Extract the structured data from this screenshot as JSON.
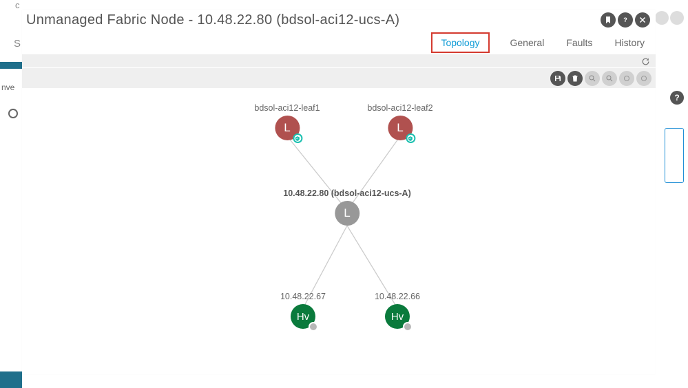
{
  "header": {
    "title": "Unmanaged Fabric Node - 10.48.22.80 (bdsol-aci12-ucs-A)"
  },
  "tabs": {
    "items": [
      "Topology",
      "General",
      "Faults",
      "History"
    ],
    "active": "Topology"
  },
  "topology": {
    "nodes": {
      "leaf1": {
        "label": "bdsol-aci12-leaf1",
        "letter": "L"
      },
      "leaf2": {
        "label": "bdsol-aci12-leaf2",
        "letter": "L"
      },
      "center": {
        "label": "10.48.22.80 (bdsol-aci12-ucs-A)",
        "letter": "L"
      },
      "hv1": {
        "label": "10.48.22.67",
        "letter": "Hv"
      },
      "hv2": {
        "label": "10.48.22.66",
        "letter": "Hv"
      }
    }
  },
  "bg": {
    "s": "S",
    "c": "c",
    "inv": "nve"
  }
}
